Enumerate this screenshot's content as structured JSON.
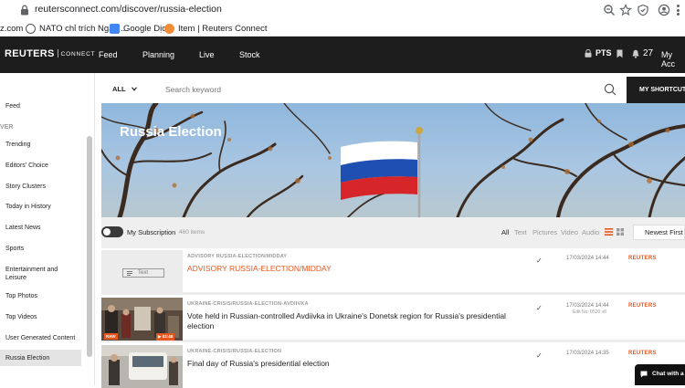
{
  "browser": {
    "url": "reutersconnect.com/discover/russia-election",
    "bookmarks": [
      {
        "label": "z.com"
      },
      {
        "label": "NATO chỉ trích Nga l..."
      },
      {
        "label": "Google Dịch"
      },
      {
        "label": "Item | Reuters Connect"
      }
    ]
  },
  "header": {
    "logo": "REUTERS",
    "logo_sub": "CONNECT",
    "nav": [
      "Feed",
      "Planning",
      "Live",
      "Stock"
    ],
    "pts_label": "PTS",
    "count": "27",
    "account": "My Acc"
  },
  "sidebar": {
    "top_item": "Feed",
    "section": "VER",
    "items": [
      "Trending",
      "Editors' Choice",
      "Story Clusters",
      "Today in History",
      "Latest News",
      "Sports",
      "Entertainment and Leisure",
      "Top Photos",
      "Top Videos",
      "User Generated Content",
      "Russia Election"
    ]
  },
  "search": {
    "scope": "ALL",
    "placeholder": "Search keyword",
    "shortcut_label": "MY SHORTCUTS"
  },
  "banner": {
    "title": "Russia Election"
  },
  "filters": {
    "subscription_label": "My Subscription",
    "count": "460 items",
    "types": [
      "All",
      "Text",
      "Pictures",
      "Video",
      "Audio"
    ],
    "sort": "Newest First"
  },
  "results": [
    {
      "slug": "ADVISORY RUSSIA-ELECTION/MIDDAY",
      "headline": "ADVISORY RUSSIA-ELECTION/MIDDAY",
      "date": "17/03/2024 14:44",
      "edit": "",
      "source": "REUTERS",
      "thumb_label": "Text"
    },
    {
      "slug": "UKRAINE-CRISIS/RUSSIA-ELECTION-AVDIIVKA",
      "headline": "Vote held in Russian-controlled Avdiivka in Ukraine's Donetsk region for Russia's presidential election",
      "date": "17/03/2024 14:44",
      "edit": "Edit No: 0520 v8",
      "source": "REUTERS",
      "badge1": "RAW",
      "badge2": "▶ 02:48"
    },
    {
      "slug": "UKRAINE-CRISIS/RUSSIA-ELECTION",
      "headline": "Final day of Russia's presidential election",
      "date": "17/03/2024 14:35",
      "edit": "",
      "source": "REUTERS"
    }
  ],
  "chat": {
    "label": "Chat with a"
  }
}
